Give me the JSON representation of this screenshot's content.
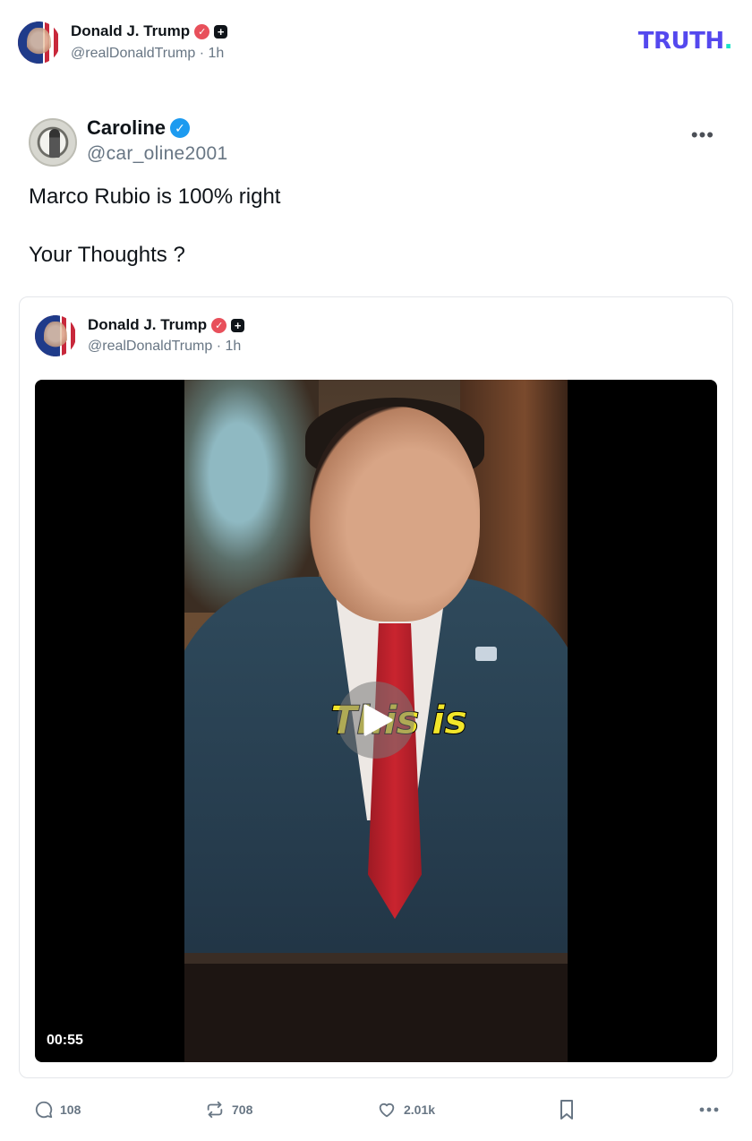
{
  "author": {
    "name": "Donald J. Trump",
    "handle": "@realDonaldTrump",
    "time": "· 1h",
    "verified_badge_color": "#e8505b",
    "plus_badge": "+"
  },
  "brand": {
    "logo_text": "TRUTH",
    "logo_dot": ".",
    "color": "#5448ee",
    "dot_color": "#17e2c7"
  },
  "tweet": {
    "name": "Caroline",
    "handle": "@car_oline2001",
    "verified_badge_color": "#1d9bf0",
    "more_label": "•••",
    "lines": [
      "Marco Rubio is 100% right",
      "Your Thoughts ?"
    ]
  },
  "card": {
    "name": "Donald J. Trump",
    "handle": "@realDonaldTrump",
    "time": "· 1h",
    "video": {
      "caption_word": "This is",
      "duration": "00:55",
      "play_icon": "play-icon"
    }
  },
  "actions": {
    "reply_count": "108",
    "retruth_count": "708",
    "like_count": "2.01k",
    "icons": [
      "reply-icon",
      "retruth-icon",
      "like-icon",
      "bookmark-icon",
      "more-icon"
    ]
  }
}
